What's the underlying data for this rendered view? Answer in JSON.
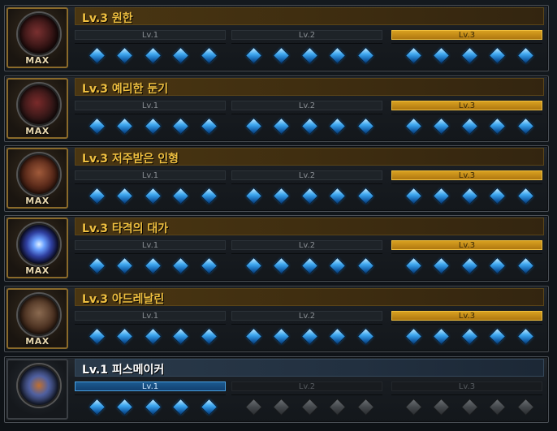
{
  "skills": [
    {
      "title": "Lv.3 원한",
      "badge": "MAX",
      "current_level": 3,
      "max_levels": 3
    },
    {
      "title": "Lv.3 예리한 둔기",
      "badge": "MAX",
      "current_level": 3,
      "max_levels": 3
    },
    {
      "title": "Lv.3 저주받은 인형",
      "badge": "MAX",
      "current_level": 3,
      "max_levels": 3
    },
    {
      "title": "Lv.3 타격의 대가",
      "badge": "MAX",
      "current_level": 3,
      "max_levels": 3
    },
    {
      "title": "Lv.3 아드레날린",
      "badge": "MAX",
      "current_level": 3,
      "max_levels": 3
    },
    {
      "title": "Lv.1 피스메이커",
      "badge": "",
      "current_level": 1,
      "max_levels": 3
    }
  ],
  "level_labels": [
    "Lv.1",
    "Lv.2",
    "Lv.3"
  ],
  "gems_per_level": 5,
  "colors": {
    "max_gold": "#f0c040",
    "active_blue": "#3fa8f0",
    "inactive_gray": "#44484c"
  }
}
